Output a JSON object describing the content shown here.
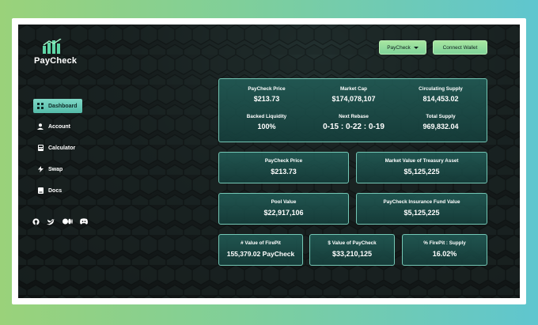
{
  "brand": {
    "name": "PayCheck"
  },
  "header": {
    "paycheck_dropdown": "PayCheck",
    "connect_wallet": "Connect Wallet"
  },
  "sidebar": {
    "items": [
      {
        "label": "Dashboard",
        "icon": "dashboard-icon",
        "active": true
      },
      {
        "label": "Account",
        "icon": "user-icon"
      },
      {
        "label": "Calculator",
        "icon": "calculator-icon"
      },
      {
        "label": "Swap",
        "icon": "lightning-icon"
      },
      {
        "label": "Docs",
        "icon": "docs-icon"
      }
    ],
    "socials": [
      "github-icon",
      "twitter-icon",
      "medium-icon",
      "discord-icon"
    ]
  },
  "overview": {
    "paycheck_price": {
      "label": "PayCheck Price",
      "value": "$213.73"
    },
    "market_cap": {
      "label": "Market Cap",
      "value": "$174,078,107"
    },
    "circulating_supply": {
      "label": "Circulating Supply",
      "value": "814,453.02"
    },
    "backed_liquidity": {
      "label": "Backed Liquidity",
      "value": "100%"
    },
    "next_rebase": {
      "label": "Next Rebase",
      "value": "0-15 : 0-22 : 0-19"
    },
    "total_supply": {
      "label": "Total Supply",
      "value": "969,832.04"
    }
  },
  "cards": {
    "price": {
      "label": "PayCheck Price",
      "value": "$213.73"
    },
    "treasury": {
      "label": "Market Value of Treasury Asset",
      "value": "$5,125,225"
    },
    "pool": {
      "label": "Pool Value",
      "value": "$22,917,106"
    },
    "insurance": {
      "label": "PayCheck Insurance Fund Value",
      "value": "$5,125,225"
    },
    "firepit_count": {
      "label": "# Value of FirePit",
      "value": "155,379.02 PayCheck"
    },
    "firepit_usd": {
      "label": "$ Value of PayCheck",
      "value": "$33,210,125"
    },
    "firepit_supply": {
      "label": "% FirePit : Supply",
      "value": "16.02%"
    }
  },
  "colors": {
    "accent": "#74c7b5",
    "button": "#a7e6a0",
    "background": "#151b1b"
  }
}
